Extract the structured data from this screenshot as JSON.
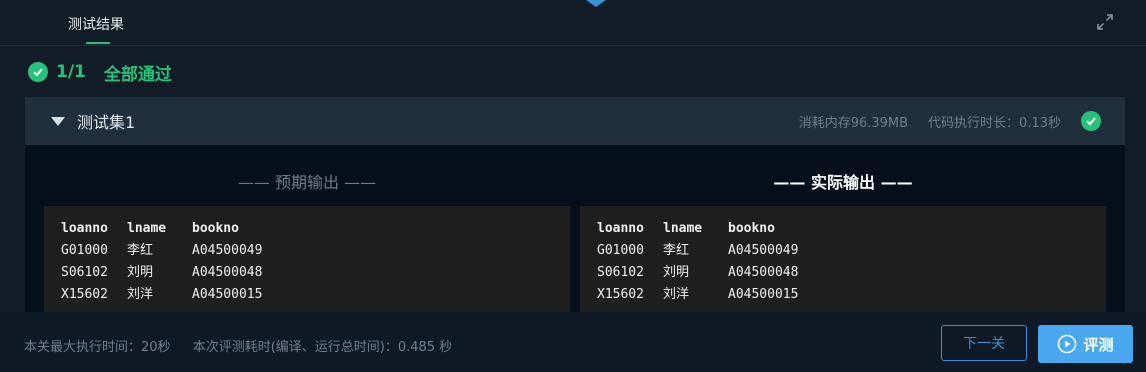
{
  "tabs": {
    "active": "测试结果"
  },
  "summary": {
    "score": "1/1",
    "status": "全部通过"
  },
  "test_set": {
    "title": "测试集1",
    "memory": "消耗内存96.39MB",
    "exec_time": "代码执行时长：0.13秒"
  },
  "expected": {
    "title": "—— 预期输出 ——",
    "header": [
      "loanno",
      "lname",
      "bookno"
    ],
    "rows": [
      [
        "G01000",
        "李红",
        "A04500049"
      ],
      [
        "S06102",
        "刘明",
        "A04500048"
      ],
      [
        "X15602",
        "刘洋",
        "A04500015"
      ]
    ]
  },
  "actual": {
    "title": "—— 实际输出 ——",
    "header": [
      "loanno",
      "lname",
      "bookno"
    ],
    "rows": [
      [
        "G01000",
        "李红",
        "A04500049"
      ],
      [
        "S06102",
        "刘明",
        "A04500048"
      ],
      [
        "X15602",
        "刘洋",
        "A04500015"
      ]
    ]
  },
  "footer": {
    "max_time": "本关最大执行时间：20秒",
    "eval_time": "本次评测耗时(编译、运行总时间)：0.485 秒",
    "next_label": "下一关",
    "judge_label": "评测"
  },
  "colors": {
    "success": "#27c27a",
    "accent": "#3a8fd6",
    "button": "#4aa8f0"
  }
}
